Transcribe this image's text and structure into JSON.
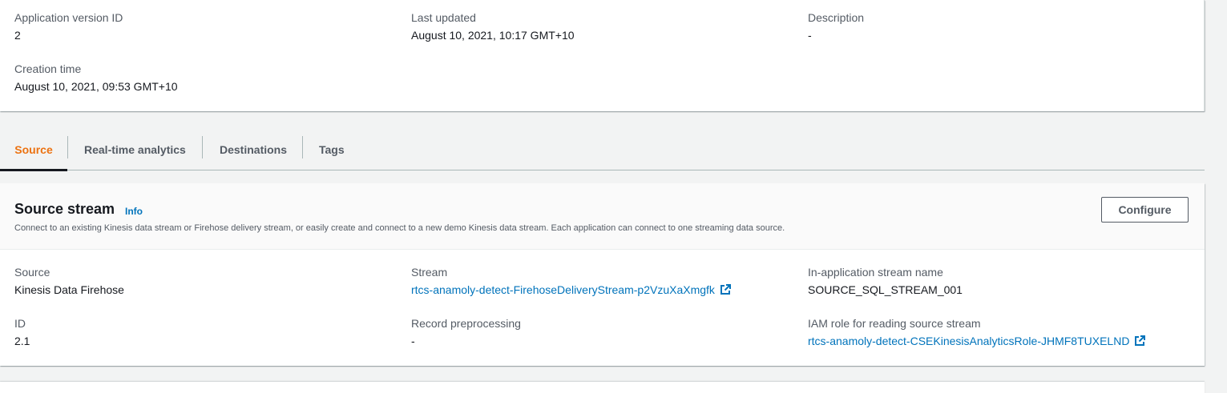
{
  "version_details": {
    "app_version_label": "Application version ID",
    "app_version_value": "2",
    "last_updated_label": "Last updated",
    "last_updated_value": "August 10, 2021, 10:17 GMT+10",
    "description_label": "Description",
    "description_value": "-",
    "creation_time_label": "Creation time",
    "creation_time_value": "August 10, 2021, 09:53 GMT+10"
  },
  "tabs": [
    {
      "label": "Source",
      "active": true
    },
    {
      "label": "Real-time analytics",
      "active": false
    },
    {
      "label": "Destinations",
      "active": false
    },
    {
      "label": "Tags",
      "active": false
    }
  ],
  "source_stream": {
    "title": "Source stream",
    "info_label": "Info",
    "description": "Connect to an existing Kinesis data stream or Firehose delivery stream, or easily create and connect to a new demo Kinesis data stream. Each application can connect to one streaming data source.",
    "configure_label": "Configure",
    "source_label": "Source",
    "source_value": "Kinesis Data Firehose",
    "stream_label": "Stream",
    "stream_value": "rtcs-anamoly-detect-FirehoseDeliveryStream-p2VzuXaXmgfk",
    "in_app_label": "In-application stream name",
    "in_app_value": "SOURCE_SQL_STREAM_001",
    "id_label": "ID",
    "id_value": "2.1",
    "preproc_label": "Record preprocessing",
    "preproc_value": "-",
    "iam_label": "IAM role for reading source stream",
    "iam_value": "rtcs-anamoly-detect-CSEKinesisAnalyticsRole-JHMF8TUXELND"
  },
  "icons": {
    "external_link": "external-link-icon"
  },
  "colors": {
    "accent": "#ec7211",
    "link": "#0073bb",
    "text": "#16191f",
    "label": "#545b64"
  }
}
